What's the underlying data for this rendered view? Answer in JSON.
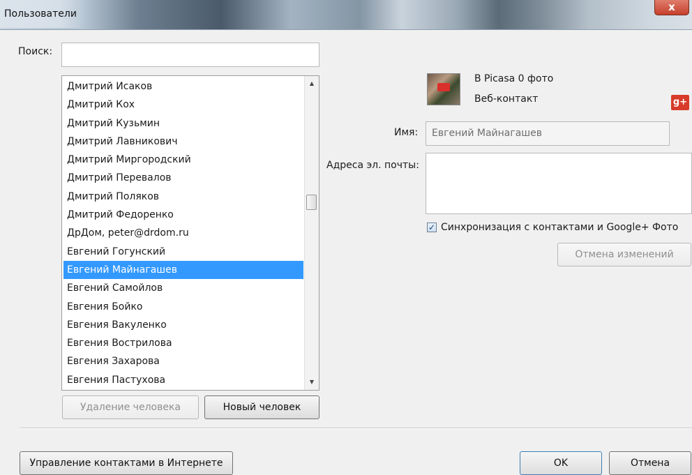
{
  "window": {
    "title": "Пользователи",
    "close_label": "x"
  },
  "search": {
    "label": "Поиск:",
    "value": ""
  },
  "people": {
    "items": [
      "Дмитрий Исаков",
      "Дмитрий Кох",
      "Дмитрий Кузьмин",
      "Дмитрий Лавникович",
      "Дмитрий Миргородский",
      "Дмитрий Перевалов",
      "Дмитрий Поляков",
      "Дмитрий Федоренко",
      "ДрДом, peter@drdom.ru",
      "Евгений Гогунский",
      "Евгений Майнагашев",
      "Евгений Самойлов",
      "Евгения Бойко",
      "Евгения Вакуленко",
      "Евгения Вострилова",
      "Евгения Захарова",
      "Евгения Пастухова"
    ],
    "selected": "Евгений Майнагашев",
    "delete_button": "Удаление человека",
    "new_button": "Новый человек",
    "scroll_up_icon": "triangle-up-icon",
    "scroll_down_icon": "triangle-down-icon"
  },
  "details": {
    "picasa_text": "В Picasa 0 фото",
    "web_contact": "Веб-контакт",
    "name_label": "Имя:",
    "name_value": "Евгений Майнагашев",
    "email_label": "Адреса эл. почты:",
    "email_value": "",
    "sync_label": "Синхронизация с контактами и Google+ Фото",
    "sync_checked": true,
    "check_mark": "✓",
    "gplus_label": "g+",
    "undo_button": "Отмена изменений"
  },
  "footer": {
    "manage_online": "Управление контактами в Интернете",
    "ok": "OK",
    "cancel": "Отмена"
  }
}
